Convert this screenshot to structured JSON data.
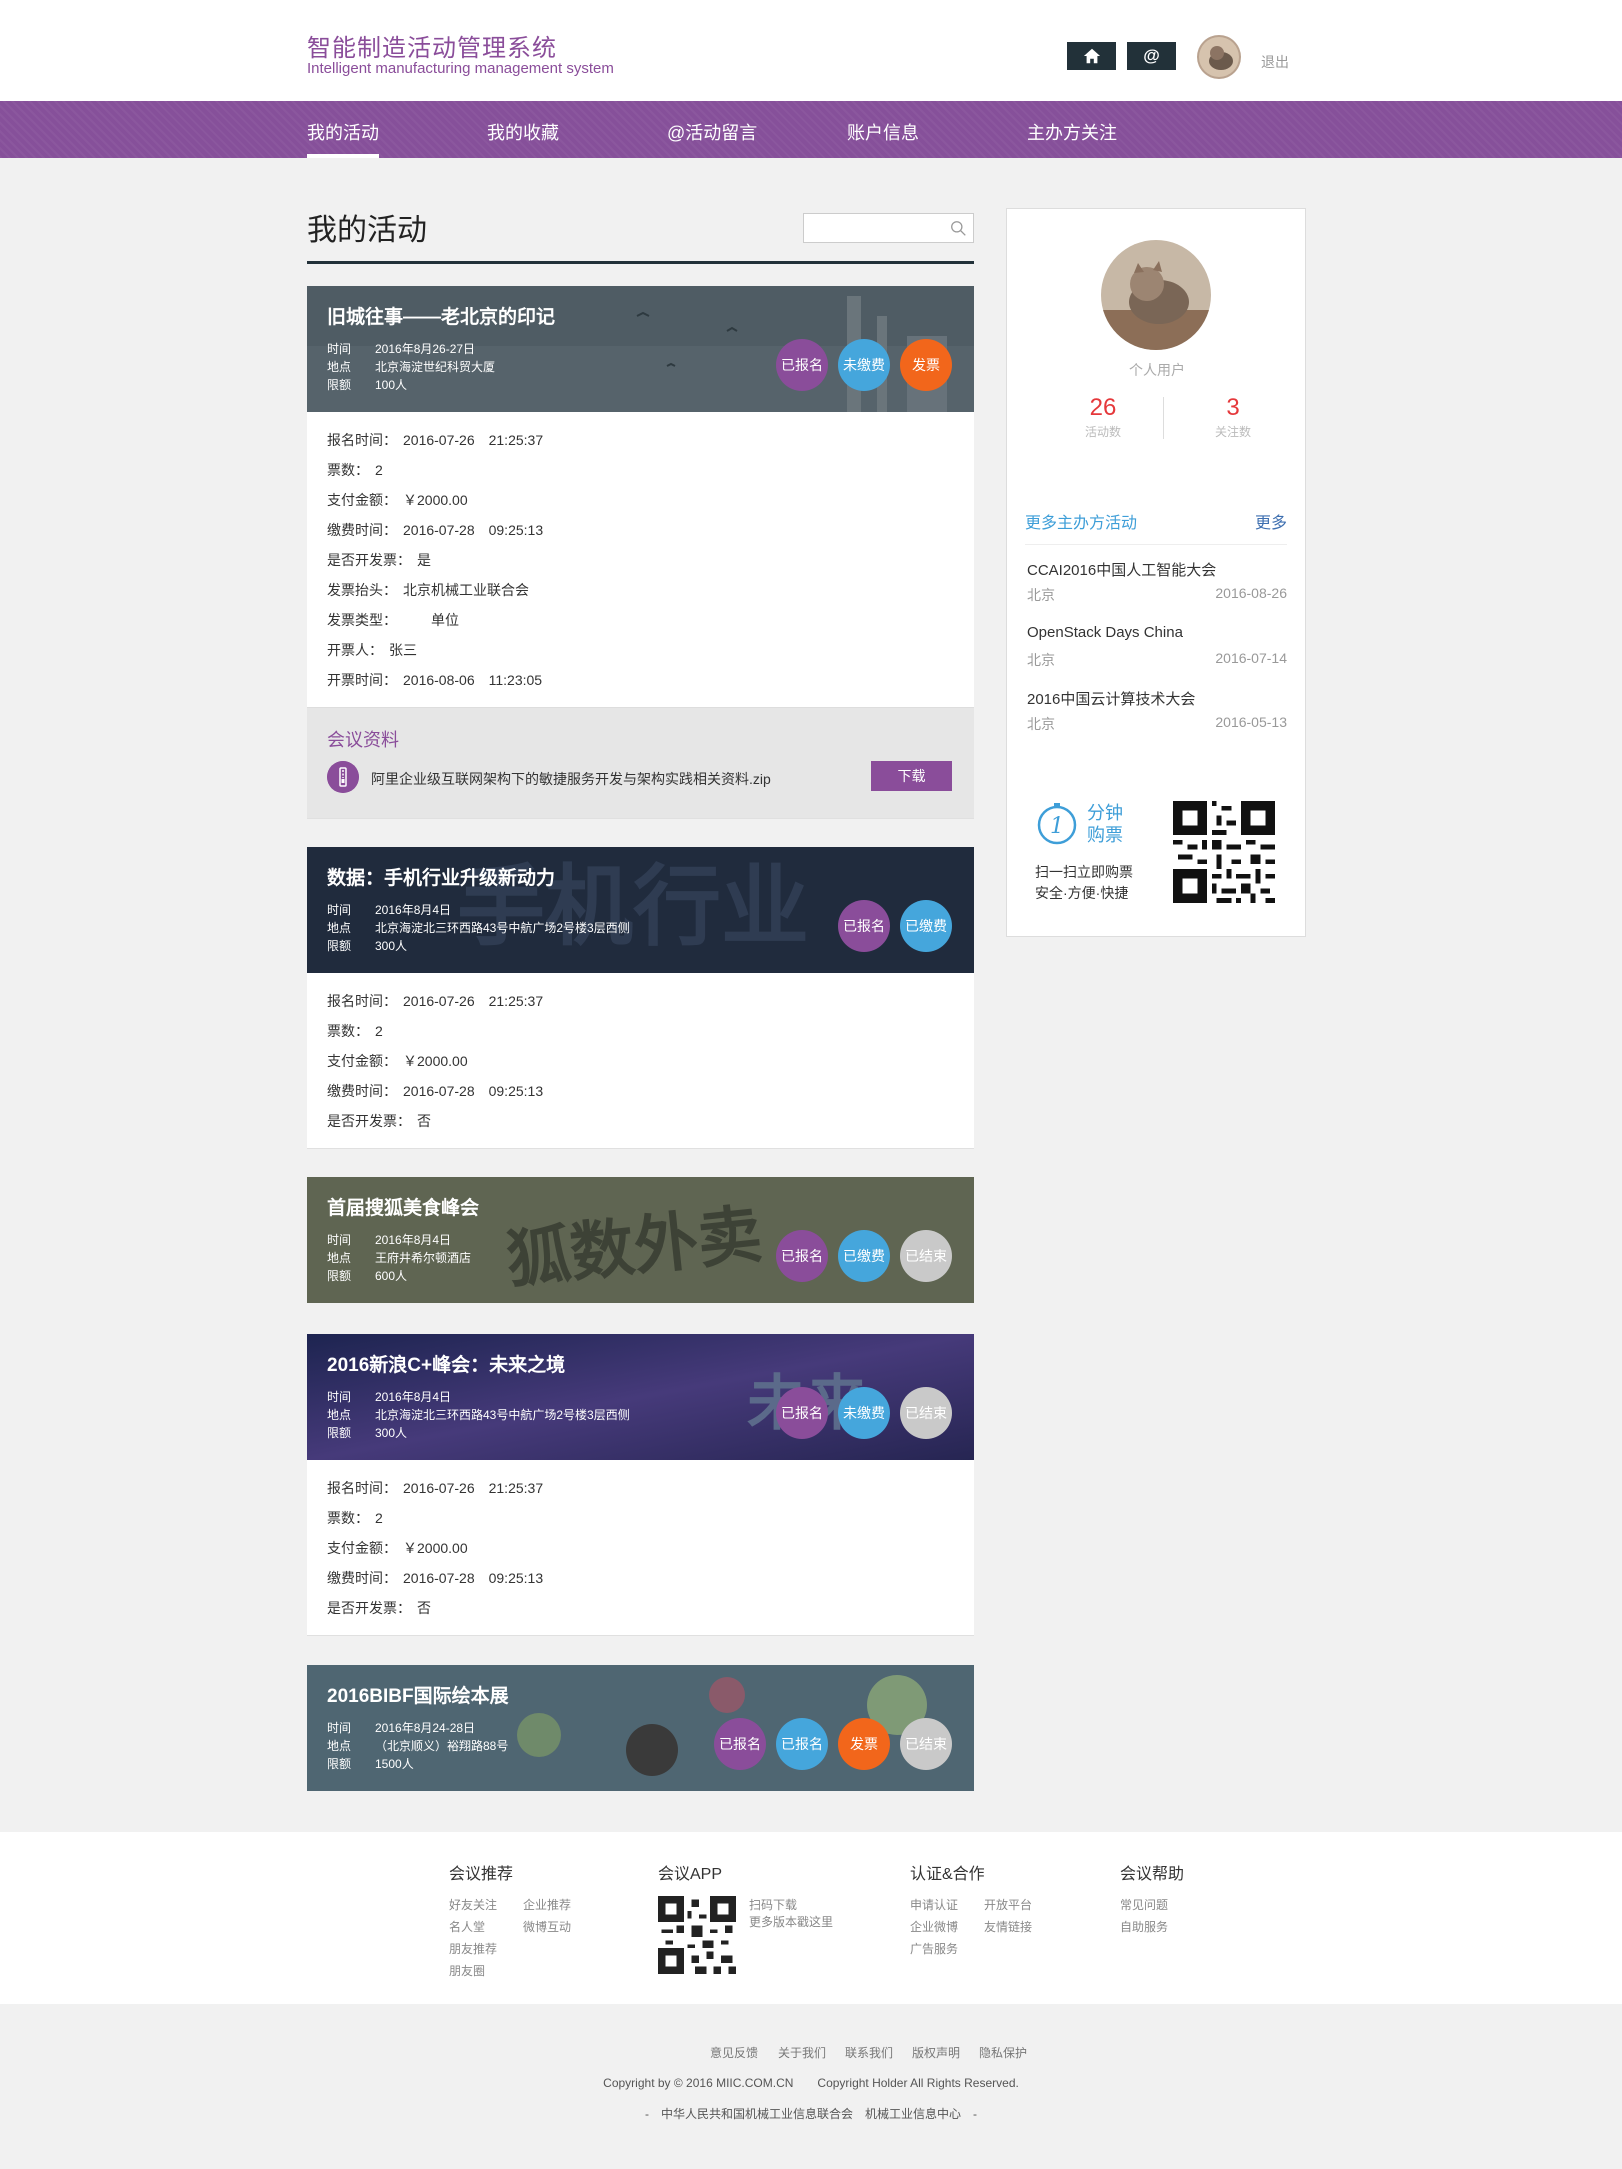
{
  "header": {
    "title_cn": "智能制造活动管理系统",
    "title_en": "Intelligent manufacturing management system",
    "home_icon": "home-icon",
    "at_label": "@",
    "logout": "退出"
  },
  "nav": {
    "items": [
      {
        "label": "我的活动",
        "active": true
      },
      {
        "label": "我的收藏"
      },
      {
        "label": "@活动留言"
      },
      {
        "label": "账户信息"
      },
      {
        "label": "主办方关注"
      }
    ]
  },
  "main": {
    "title": "我的活动",
    "search_placeholder": ""
  },
  "labels": {
    "time": "时间",
    "place": "地点",
    "quota": "限额",
    "reg_time": "报名时间：",
    "tickets": "票数：",
    "pay_amount": "支付金额：",
    "pay_time": "缴费时间：",
    "invoice_q": "是否开发票：",
    "invoice_head": "发票抬头：",
    "invoice_type": "发票类型：",
    "issuer": "开票人：",
    "issue_time": "开票时间："
  },
  "events": [
    {
      "title": "旧城往事——老北京的印记",
      "time": "2016年8月26-27日",
      "place": "北京海淀世纪科贸大厦",
      "quota": "100人",
      "badges": [
        "已报名",
        "未缴费",
        "发票"
      ],
      "details": {
        "reg_time": "2016-07-26　21:25:37",
        "tickets": "2",
        "pay_amount": "￥2000.00",
        "pay_time": "2016-07-28　09:25:13",
        "invoice_q": "是",
        "invoice_head": "北京机械工业联合会",
        "invoice_type": "单位",
        "issuer": "张三",
        "issue_time": "2016-08-06　11:23:05"
      },
      "materials": {
        "title": "会议资料",
        "file_name": "阿里企业级互联网架构下的敏捷服务开发与架构实践相关资料.zip",
        "download": "下载"
      }
    },
    {
      "title": "数据：手机行业升级新动力",
      "time": "2016年8月4日",
      "place": "北京海淀北三环西路43号中航广场2号楼3层西侧",
      "quota": "300人",
      "badges": [
        "已报名",
        "已缴费"
      ],
      "details": {
        "reg_time": "2016-07-26　21:25:37",
        "tickets": "2",
        "pay_amount": "￥2000.00",
        "pay_time": "2016-07-28　09:25:13",
        "invoice_q": "否"
      }
    },
    {
      "title": "首届搜狐美食峰会",
      "time": "2016年8月4日",
      "place": "王府井希尔顿酒店",
      "quota": "600人",
      "badges": [
        "已报名",
        "已缴费",
        "已结束"
      ]
    },
    {
      "title": "2016新浪C+峰会：未来之境",
      "time": "2016年8月4日",
      "place": "北京海淀北三环西路43号中航广场2号楼3层西侧",
      "quota": "300人",
      "badges": [
        "已报名",
        "未缴费",
        "已结束"
      ],
      "details": {
        "reg_time": "2016-07-26　21:25:37",
        "tickets": "2",
        "pay_amount": "￥2000.00",
        "pay_time": "2016-07-28　09:25:13",
        "invoice_q": "否"
      }
    },
    {
      "title": "2016BIBF国际绘本展",
      "time": "2016年8月24-28日",
      "place": "（北京顺义）裕翔路88号",
      "quota": "1500人",
      "badges": [
        "已报名",
        "已报名",
        "发票",
        "已结束"
      ]
    }
  ],
  "sidebar": {
    "role": "个人用户",
    "activities_count": "26",
    "activities_label": "活动数",
    "follows_count": "3",
    "follows_label": "关注数",
    "more_title": "更多主办方活动",
    "more_link": "更多",
    "activities": [
      {
        "title": "CCAI2016中国人工智能大会",
        "city": "北京",
        "date": "2016-08-26"
      },
      {
        "title": "OpenStack Days China",
        "city": "北京",
        "date": "2016-07-14"
      },
      {
        "title": "2016中国云计算技术大会",
        "city": "北京",
        "date": "2016-05-13"
      }
    ],
    "clock_number": "1",
    "clock_line1": "分钟",
    "clock_line2": "购票",
    "scan_line1": "扫一扫立即购票",
    "scan_line2": "安全·方便·快捷"
  },
  "footer": {
    "cols": [
      {
        "title": "会议推荐",
        "links": [
          "好友关注",
          "企业推荐",
          "名人堂",
          "微博互动",
          "朋友推荐",
          "朋友圈"
        ]
      },
      {
        "title": "会议APP",
        "links": [
          "扫码下载",
          "更多版本戳这里"
        ]
      },
      {
        "title": "认证&合作",
        "links": [
          "申请认证",
          "开放平台",
          "企业微博",
          "友情链接",
          "广告服务"
        ]
      },
      {
        "title": "会议帮助",
        "links": [
          "常见问题",
          "自助服务"
        ]
      }
    ],
    "bottom_links": [
      "意见反馈",
      "关于我们",
      "联系我们",
      "版权声明",
      "隐私保护"
    ],
    "copyright": "Copyright by © 2016 MIIC.COM.CN　　Copyright Holder All Rights Reserved.",
    "org": "-　中华人民共和国机械工业信息联合会　机械工业信息中心　-"
  },
  "colors": {
    "brand_purple": "#86509a",
    "dark": "#223139",
    "blue": "#45a6dc",
    "orange": "#f2661b",
    "grey": "#c9c9c9",
    "red": "#e5383b"
  }
}
